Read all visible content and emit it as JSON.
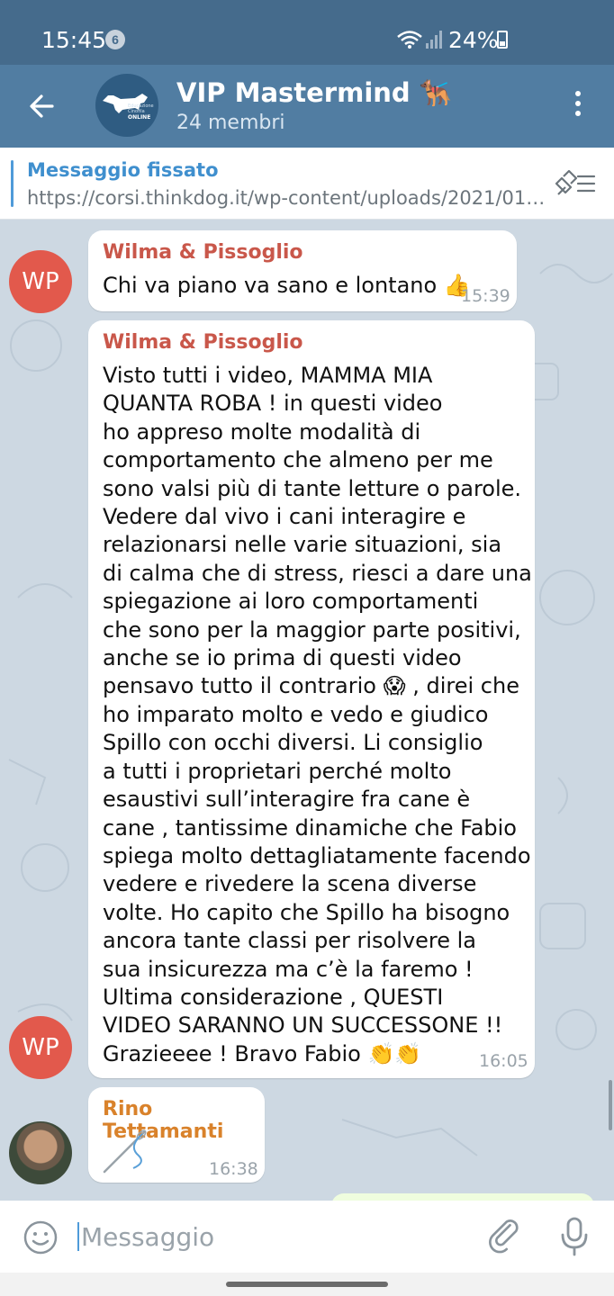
{
  "status": {
    "time": "15:45",
    "notification_count": "6",
    "battery": "24%"
  },
  "header": {
    "title": "VIP Mastermind 🐕‍🦺",
    "subtitle": "24 membri",
    "avatar_lines": [
      "Educazione",
      "Cinofila",
      "ONLINE"
    ]
  },
  "pinned": {
    "title": "Messaggio fissato",
    "text": "https://corsi.thinkdog.it/wp-content/uploads/2021/01/..."
  },
  "messages": [
    {
      "sender": "Wilma & Pissoglio",
      "avatar_initials": "WP",
      "text": "Chi va piano va sano e lontano 👍",
      "time": "15:39"
    },
    {
      "sender": "Wilma & Pissoglio",
      "avatar_initials": "WP",
      "lines": [
        "Visto tutti i video, MAMMA MIA",
        "QUANTA ROBA ! in questi video",
        "ho appreso molte modalità di",
        "comportamento che almeno per me",
        "sono valsi più di tante letture o parole.",
        "Vedere dal vivo i cani interagire e",
        "relazionarsi nelle varie situazioni, sia",
        "di calma che di stress, riesci a dare una",
        "spiegazione ai loro comportamenti",
        "che sono per la maggior parte positivi,",
        "anche se io prima di questi video",
        "pensavo tutto il contrario 😱 , direi che",
        "ho imparato molto e vedo e giudico",
        "Spillo con occhi diversi. Li consiglio",
        "a tutti i proprietari perché molto",
        "esaustivi sull’interagire fra cane è",
        "cane , tantissime dinamiche che Fabio",
        "spiega molto dettagliatamente facendo",
        "vedere e rivedere la scena diverse",
        "volte. Ho capito che Spillo ha bisogno",
        "ancora tante classi per risolvere la",
        "sua insicurezza ma c’è la faremo !",
        "Ultima considerazione , QUESTI",
        "VIDEO SARANNO UN SUCCESSONE !!",
        "Grazieeee ! Bravo Fabio 👏👏"
      ],
      "time": "16:05"
    },
    {
      "sender": "Rino Tettamanti",
      "sticker": "needle",
      "time": "16:38"
    }
  ],
  "input": {
    "placeholder": "Messaggio"
  },
  "icons": [
    "back-arrow-icon",
    "more-vert-icon",
    "pinned-list-icon",
    "emoji-icon",
    "paperclip-icon",
    "microphone-icon",
    "wifi-icon",
    "signal-icon",
    "battery-icon"
  ]
}
